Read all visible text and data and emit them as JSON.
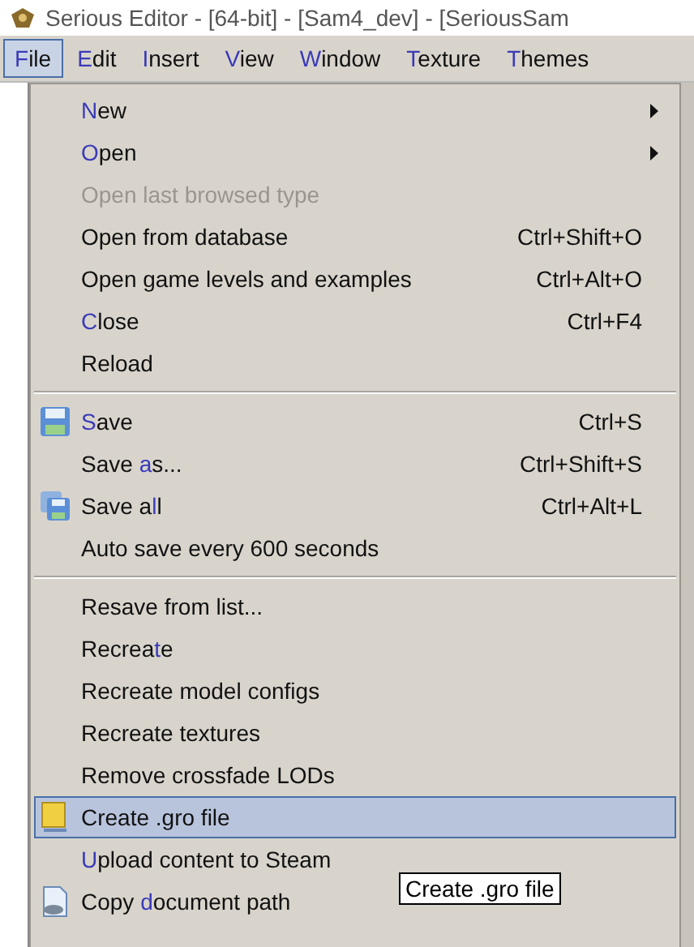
{
  "window": {
    "title": "Serious Editor - [64-bit] - [Sam4_dev] - [SeriousSam"
  },
  "menubar": [
    {
      "key": "F",
      "after": "ile",
      "selected": true
    },
    {
      "key": "E",
      "after": "dit",
      "selected": false
    },
    {
      "key": "I",
      "after": "nsert",
      "selected": false
    },
    {
      "key": "V",
      "after": "iew",
      "selected": false
    },
    {
      "key": "W",
      "after": "indow",
      "selected": false
    },
    {
      "key": "T",
      "after": "exture",
      "selected": false
    },
    {
      "key": "T",
      "after": "hemes",
      "selected": false
    }
  ],
  "menu": [
    {
      "kind": "item",
      "key": "N",
      "after": "ew",
      "submenu": true,
      "disabled": false,
      "selected": false
    },
    {
      "kind": "item",
      "key": "O",
      "after": "pen",
      "submenu": true,
      "disabled": false,
      "selected": false
    },
    {
      "kind": "item",
      "before": "Open last browsed type",
      "submenu": false,
      "disabled": true,
      "selected": false
    },
    {
      "kind": "item",
      "before": "Open from database",
      "shortcut": "Ctrl+Shift+O",
      "submenu": false,
      "disabled": false,
      "selected": false
    },
    {
      "kind": "item",
      "before": "Open game levels and examples",
      "shortcut": "Ctrl+Alt+O",
      "submenu": false,
      "disabled": false,
      "selected": false
    },
    {
      "kind": "item",
      "key": "C",
      "after": "lose",
      "shortcut": "Ctrl+F4",
      "submenu": false,
      "disabled": false,
      "selected": false
    },
    {
      "kind": "item",
      "before": "Reload",
      "submenu": false,
      "disabled": false,
      "selected": false
    },
    {
      "kind": "separator"
    },
    {
      "kind": "item",
      "key": "S",
      "after": "ave",
      "shortcut": "Ctrl+S",
      "submenu": false,
      "disabled": false,
      "selected": false
    },
    {
      "kind": "item",
      "before": "Save ",
      "key": "a",
      "after": "s...",
      "shortcut": "Ctrl+Shift+S",
      "submenu": false,
      "disabled": false,
      "selected": false
    },
    {
      "kind": "item",
      "before": "Save a",
      "key": "l",
      "after": "l",
      "shortcut": "Ctrl+Alt+L",
      "submenu": false,
      "disabled": false,
      "selected": false
    },
    {
      "kind": "item",
      "before": "Auto save every 600 seconds",
      "submenu": false,
      "disabled": false,
      "selected": false
    },
    {
      "kind": "separator"
    },
    {
      "kind": "item",
      "before": "Resave from list...",
      "submenu": false,
      "disabled": false,
      "selected": false
    },
    {
      "kind": "item",
      "before": "Recrea",
      "key": "t",
      "after": "e",
      "submenu": false,
      "disabled": false,
      "selected": false
    },
    {
      "kind": "item",
      "before": "Recreate model configs",
      "submenu": false,
      "disabled": false,
      "selected": false
    },
    {
      "kind": "item",
      "before": "Recreate textures",
      "submenu": false,
      "disabled": false,
      "selected": false
    },
    {
      "kind": "item",
      "before": "Remove crossfade LODs",
      "submenu": false,
      "disabled": false,
      "selected": false
    },
    {
      "kind": "item",
      "before": "Create .gro file",
      "submenu": false,
      "disabled": false,
      "selected": true
    },
    {
      "kind": "item",
      "key": "U",
      "after": "pload content to Steam",
      "submenu": false,
      "disabled": false,
      "selected": false
    },
    {
      "kind": "item",
      "before": "Copy ",
      "key": "d",
      "after": "ocument path",
      "submenu": false,
      "disabled": false,
      "selected": false
    }
  ],
  "tooltip": "Create .gro file"
}
